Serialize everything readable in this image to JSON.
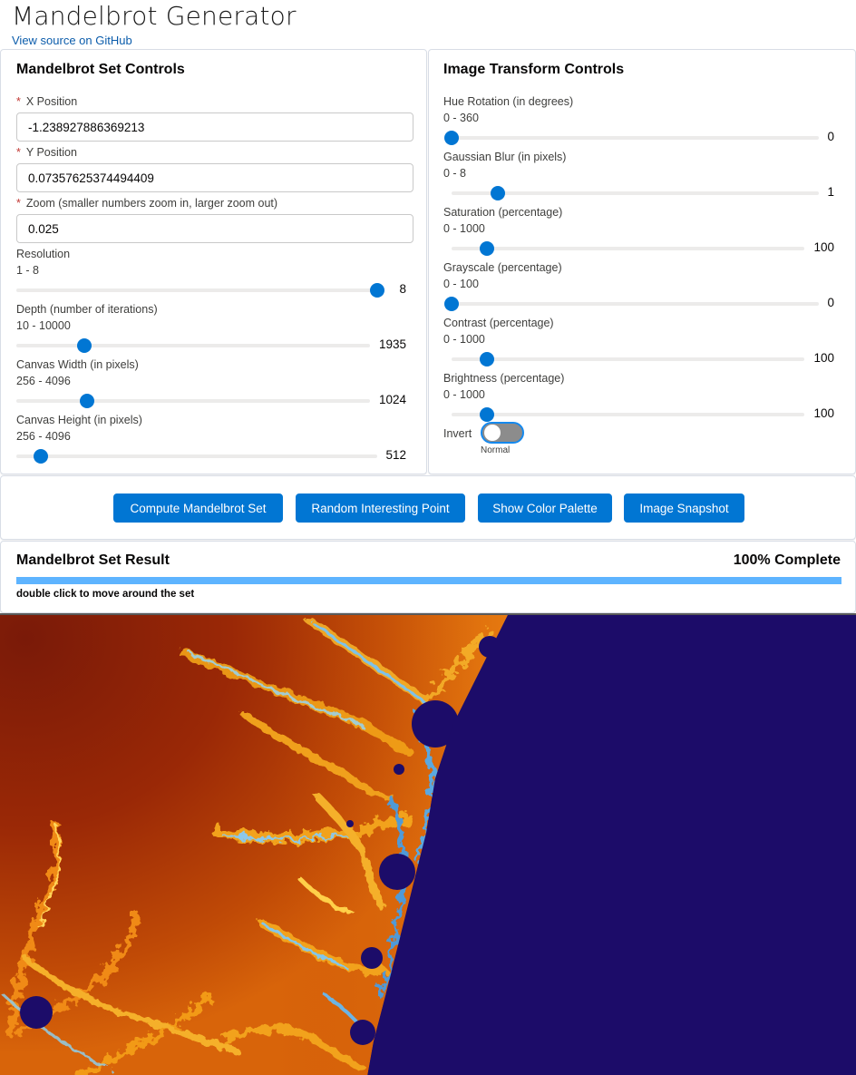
{
  "app": {
    "title": "Mandelbrot Generator",
    "source_link": "View source on GitHub"
  },
  "set_controls": {
    "title": "Mandelbrot Set Controls",
    "x_position": {
      "label": "X Position",
      "required": true,
      "value": "-1.238927886369213"
    },
    "y_position": {
      "label": "Y Position",
      "required": true,
      "value": "0.07357625374494409"
    },
    "zoom": {
      "label": "Zoom (smaller numbers zoom in, larger zoom out)",
      "required": true,
      "value": "0.025"
    },
    "resolution": {
      "label": "Resolution",
      "range": "1 - 8",
      "min": 1,
      "max": 8,
      "value": 8,
      "display": "8"
    },
    "depth": {
      "label": "Depth (number of iterations)",
      "range": "10 - 10000",
      "min": 10,
      "max": 10000,
      "value": 1935,
      "display": "1935"
    },
    "canvas_width": {
      "label": "Canvas Width (in pixels)",
      "range": "256 - 4096",
      "min": 256,
      "max": 4096,
      "value": 1024,
      "display": "1024"
    },
    "canvas_height": {
      "label": "Canvas Height (in pixels)",
      "range": "256 - 4096",
      "min": 256,
      "max": 4096,
      "value": 512,
      "display": "512"
    }
  },
  "transform_controls": {
    "title": "Image Transform Controls",
    "hue_rotation": {
      "label": "Hue Rotation (in degrees)",
      "range": "0 - 360",
      "min": 0,
      "max": 360,
      "value": 0,
      "display": "0"
    },
    "gaussian_blur": {
      "label": "Gaussian Blur (in pixels)",
      "range": "0 - 8",
      "min": 0,
      "max": 8,
      "value": 1,
      "display": "1"
    },
    "saturation": {
      "label": "Saturation (percentage)",
      "range": "0 - 1000",
      "min": 0,
      "max": 1000,
      "value": 100,
      "display": "100"
    },
    "grayscale": {
      "label": "Grayscale (percentage)",
      "range": "0 - 100",
      "min": 0,
      "max": 100,
      "value": 0,
      "display": "0"
    },
    "contrast": {
      "label": "Contrast (percentage)",
      "range": "0 - 1000",
      "min": 0,
      "max": 1000,
      "value": 100,
      "display": "100"
    },
    "brightness": {
      "label": "Brightness (percentage)",
      "range": "0 - 1000",
      "min": 0,
      "max": 1000,
      "value": 100,
      "display": "100"
    },
    "invert": {
      "label": "Invert",
      "state": "Normal",
      "checked": false
    }
  },
  "actions": {
    "compute": "Compute Mandelbrot Set",
    "random_point": "Random Interesting Point",
    "show_palette": "Show Color Palette",
    "snapshot": "Image Snapshot"
  },
  "result": {
    "title": "Mandelbrot Set Result",
    "status": "100% Complete",
    "progress": 1.0,
    "hint": "double click to move around the set"
  },
  "colors": {
    "accent": "#0176d3",
    "progress": "#5eb4ff",
    "set_interior": "#1c0c69",
    "required": "#c23934"
  }
}
